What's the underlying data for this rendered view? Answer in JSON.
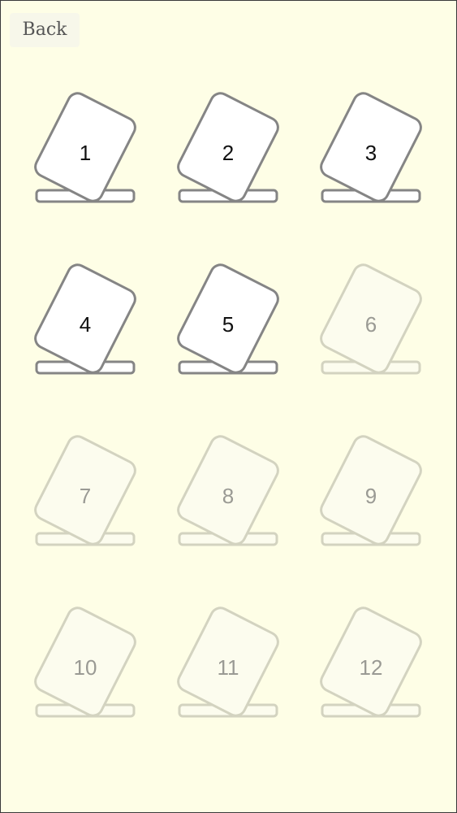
{
  "header": {
    "back_label": "Back"
  },
  "colors": {
    "background": "#fefee6",
    "unlocked_stroke": "#858585",
    "unlocked_fill": "#ffffff",
    "locked_stroke": "#d3d3c0",
    "locked_fill": "#fcfcee"
  },
  "levels": [
    {
      "label": "1",
      "unlocked": true
    },
    {
      "label": "2",
      "unlocked": true
    },
    {
      "label": "3",
      "unlocked": true
    },
    {
      "label": "4",
      "unlocked": true
    },
    {
      "label": "5",
      "unlocked": true
    },
    {
      "label": "6",
      "unlocked": false
    },
    {
      "label": "7",
      "unlocked": false
    },
    {
      "label": "8",
      "unlocked": false
    },
    {
      "label": "9",
      "unlocked": false
    },
    {
      "label": "10",
      "unlocked": false
    },
    {
      "label": "11",
      "unlocked": false
    },
    {
      "label": "12",
      "unlocked": false
    }
  ]
}
